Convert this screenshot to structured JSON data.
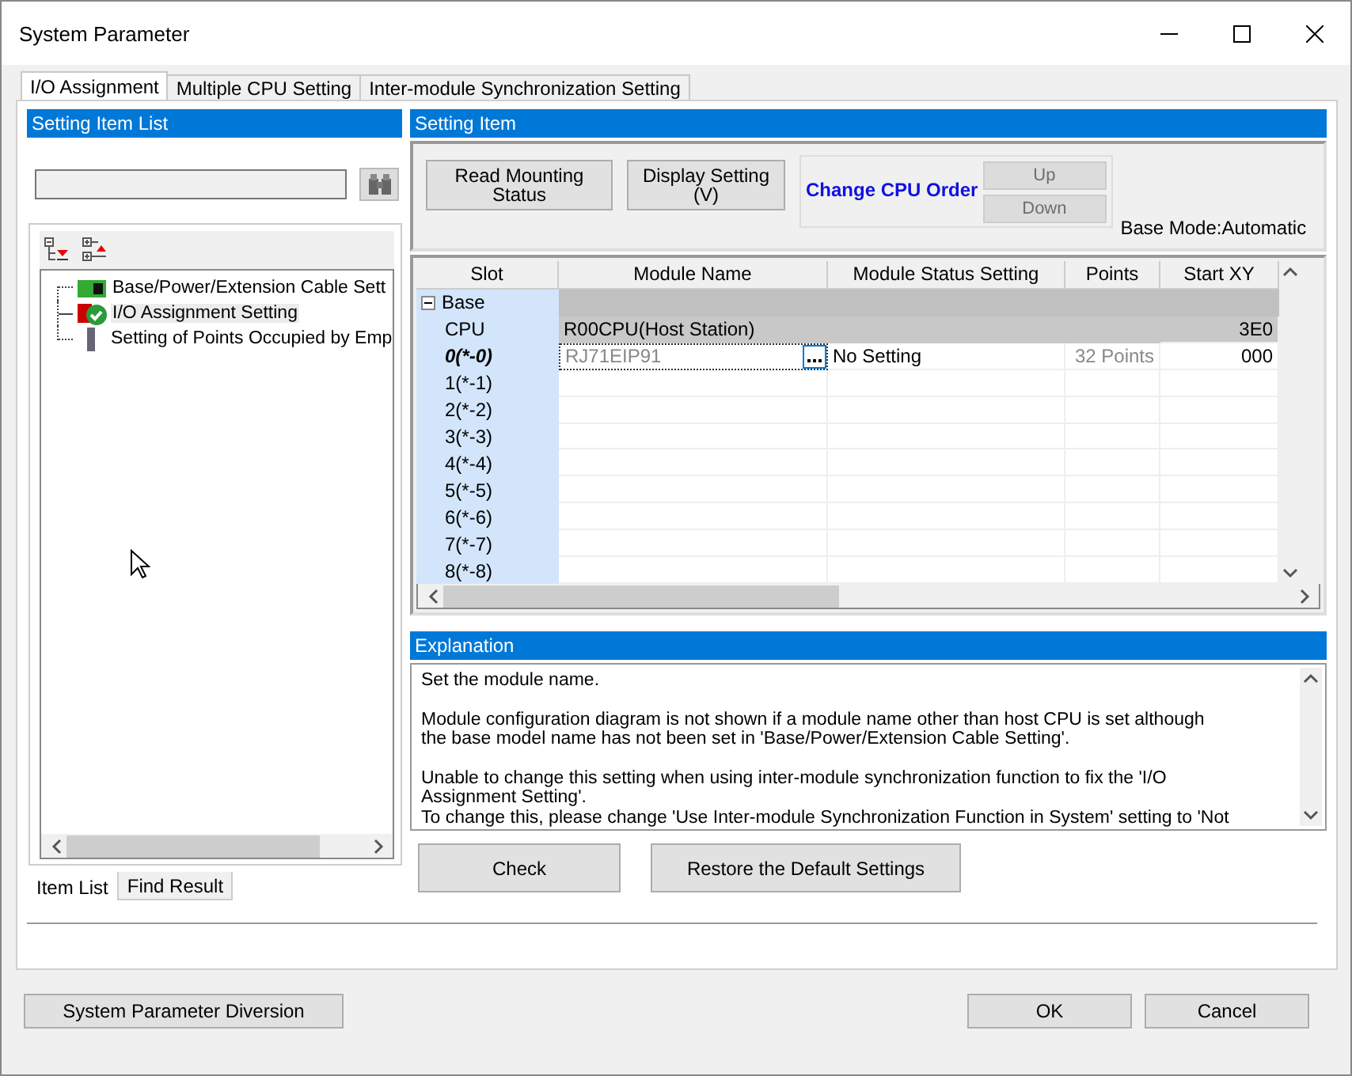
{
  "window": {
    "title": "System Parameter"
  },
  "tabs": [
    {
      "label": "I/O Assignment",
      "selected": true
    },
    {
      "label": "Multiple CPU Setting",
      "selected": false
    },
    {
      "label": "Inter-module Synchronization Setting",
      "selected": false
    }
  ],
  "setting_item_list": {
    "title": "Setting Item List",
    "tree": [
      {
        "label": "Base/Power/Extension Cable Sett",
        "kind": "base",
        "selected": false
      },
      {
        "label": "I/O Assignment Setting",
        "kind": "io",
        "selected": true
      },
      {
        "label": "Setting of Points Occupied by Emp",
        "kind": "points",
        "selected": false
      }
    ],
    "bottom_tabs": [
      {
        "label": "Item List",
        "selected": true
      },
      {
        "label": "Find Result",
        "selected": false
      }
    ]
  },
  "setting_item": {
    "title": "Setting Item",
    "buttons": [
      "Read Mounting\nStatus",
      "Display Setting\n(V)"
    ],
    "cpu_order": {
      "label": "Change CPU Order",
      "buttons": [
        {
          "label": "Up",
          "disabled": true
        },
        {
          "label": "Down",
          "disabled": true
        }
      ]
    },
    "base_mode": "Base Mode:Automatic",
    "table": {
      "columns": [
        "Slot",
        "Module Name",
        "Module Status Setting",
        "Points",
        "Start XY"
      ],
      "rows": [
        {
          "kind": "group",
          "slot": "Base",
          "expanded": true
        },
        {
          "kind": "cpu",
          "slot": "CPU",
          "module_name": "R00CPU(Host Station)",
          "start_xy": "3E0",
          "selected": false
        },
        {
          "kind": "slot",
          "slot": "0(*-0)",
          "module_name": "RJ71EIP91",
          "status": "No Setting",
          "points": "32 Points",
          "start_xy": "000",
          "selected": true
        },
        {
          "kind": "slot",
          "slot": "1(*-1)",
          "selected": false
        },
        {
          "kind": "slot",
          "slot": "2(*-2)",
          "selected": false
        },
        {
          "kind": "slot",
          "slot": "3(*-3)",
          "selected": false
        },
        {
          "kind": "slot",
          "slot": "4(*-4)",
          "selected": false
        },
        {
          "kind": "slot",
          "slot": "5(*-5)",
          "selected": false
        },
        {
          "kind": "slot",
          "slot": "6(*-6)",
          "selected": false
        },
        {
          "kind": "slot",
          "slot": "7(*-7)",
          "selected": false
        },
        {
          "kind": "slot",
          "slot": "8(*-8)",
          "selected": false
        }
      ]
    }
  },
  "explanation": {
    "title": "Explanation",
    "paragraphs": [
      "Set the module name.",
      "Module configuration diagram is not shown if a module name other than host CPU is set although\nthe base model name has not been set in 'Base/Power/Extension Cable Setting'.",
      "Unable to change this setting when using inter-module synchronization function to fix the 'I/O\nAssignment Setting'.\nTo change this, please change 'Use Inter-module Synchronization Function in System' setting to 'Not"
    ]
  },
  "panel_buttons": [
    "Check",
    "Restore the Default Settings"
  ],
  "footer": {
    "left_button": "System Parameter Diversion",
    "buttons": [
      "OK",
      "Cancel"
    ]
  }
}
